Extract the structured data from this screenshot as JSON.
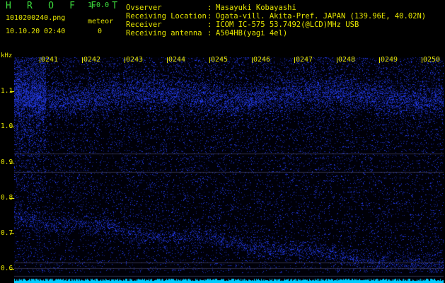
{
  "header": {
    "app_title": "H R O F F T",
    "app_version": "1.0.0",
    "file_name": "1010200240.png",
    "date_time": "10.10.20 02:40",
    "meteor_label": "meteor",
    "meteor_count": "0",
    "info": [
      {
        "key": "Ovserver",
        "value": "Masayuki Kobayashi"
      },
      {
        "key": "Receiving Location",
        "value": "Ogata-vill. Akita-Pref. JAPAN (139.96E, 40.02N)"
      },
      {
        "key": "Receiver",
        "value": "ICOM IC-575 53.7492(@LCD)MHz USB"
      },
      {
        "key": "Receiving antenna",
        "value": "A504HB(yagi 4el)"
      }
    ]
  },
  "spectrogram": {
    "y_unit": "kHz",
    "y_ticks": [
      "1.1",
      "1.0",
      "0.9",
      "0.8",
      "0.7",
      "0.6"
    ],
    "x_ticks": [
      "0241",
      "0242",
      "0243",
      "0244",
      "0245",
      "0246",
      "0247",
      "0248",
      "0249",
      "0250"
    ],
    "colors": {
      "text": "#e6e600",
      "title": "#3ddc3d",
      "signal": "#2233ff",
      "baseline": "#00ccff"
    }
  }
}
